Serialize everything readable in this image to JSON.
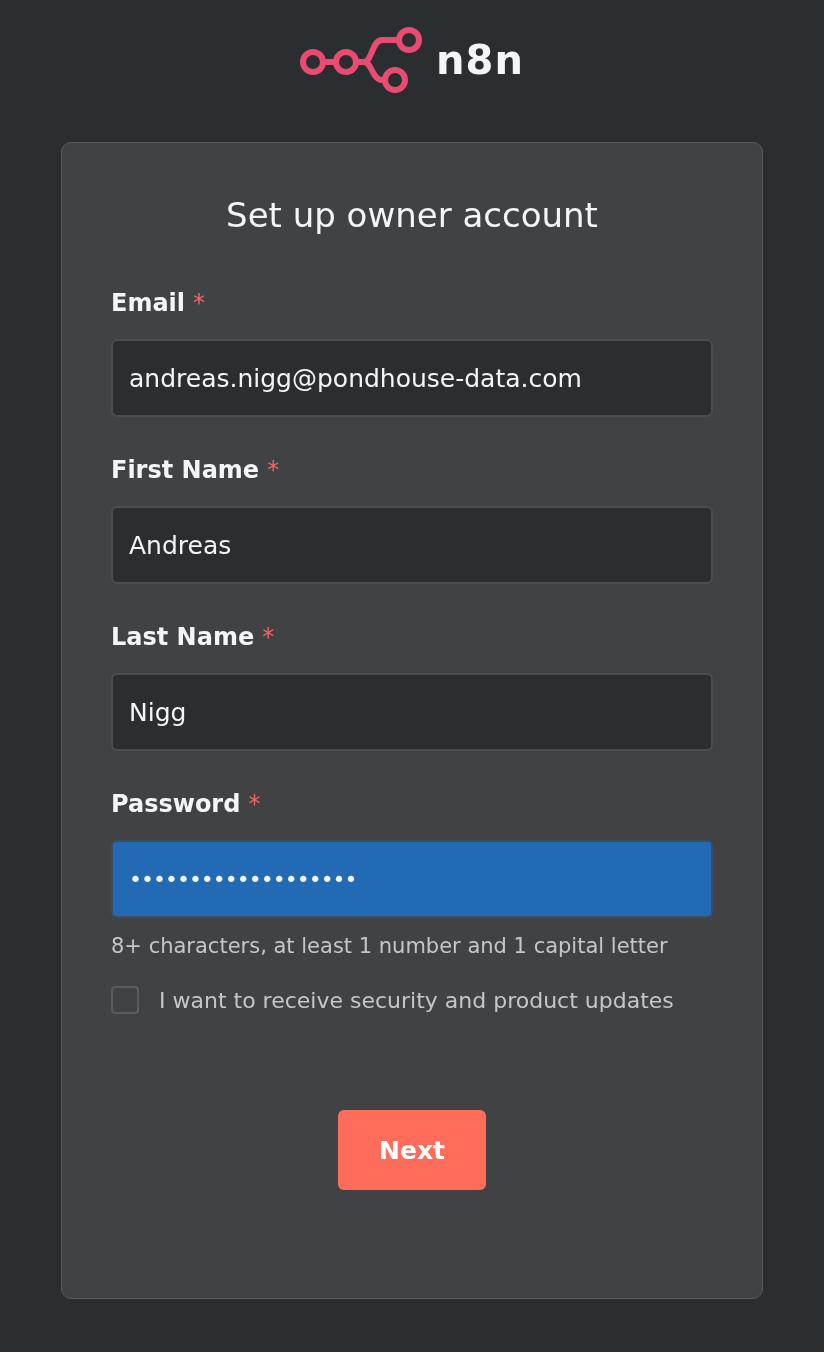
{
  "logo": {
    "text": "n8n"
  },
  "title": "Set up owner account",
  "fields": [
    {
      "label": "Email",
      "required": true,
      "value": "andreas.nigg@pondhouse-data.com",
      "highlighted": false
    },
    {
      "label": "First Name",
      "required": true,
      "value": "Andreas",
      "highlighted": false
    },
    {
      "label": "Last Name",
      "required": true,
      "value": "Nigg",
      "highlighted": false
    },
    {
      "label": "Password",
      "required": true,
      "value": "•••••••••••••••••••",
      "highlighted": true,
      "hint": "8+ characters, at least 1 number and 1 capital letter"
    }
  ],
  "required_mark": "*",
  "checkbox": {
    "label": "I want to receive security and product updates",
    "checked": false
  },
  "buttons": [
    {
      "label": "Next"
    }
  ]
}
